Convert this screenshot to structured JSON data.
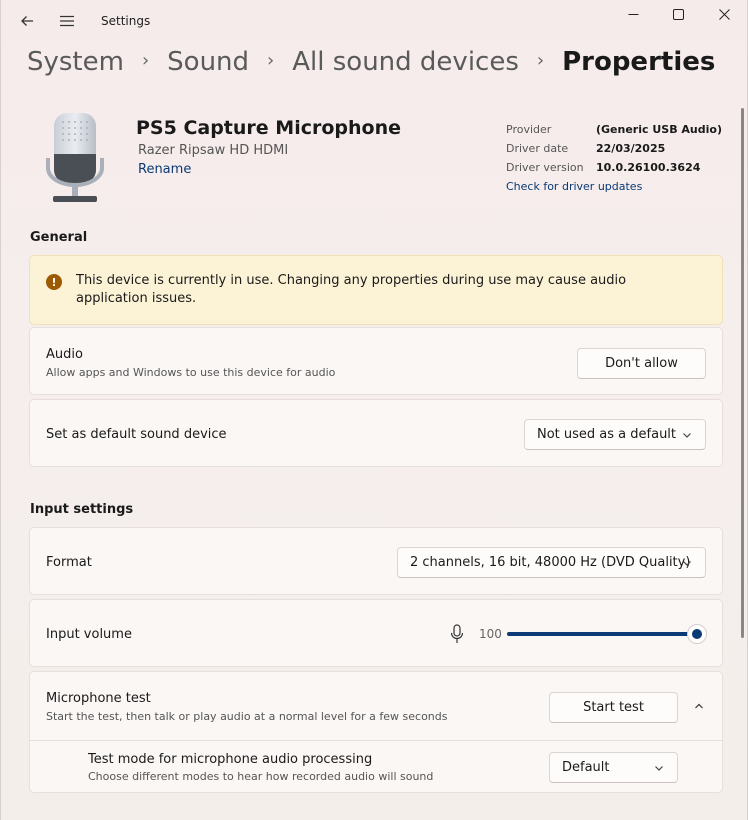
{
  "window": {
    "title": "Settings",
    "back_icon": "arrow-left-icon",
    "menu_icon": "hamburger-icon",
    "controls": [
      "minimize-icon",
      "maximize-icon",
      "close-icon"
    ]
  },
  "breadcrumb": {
    "items": [
      "System",
      "Sound",
      "All sound devices",
      "Properties"
    ],
    "separator": "›"
  },
  "device": {
    "icon": "microphone-device-icon",
    "name": "PS5 Capture Microphone",
    "subtitle": "Razer Ripsaw HD HDMI",
    "rename_label": "Rename",
    "provider_label": "Provider",
    "provider_value": "(Generic USB Audio)",
    "driver_date_label": "Driver date",
    "driver_date_value": "22/03/2025",
    "driver_version_label": "Driver version",
    "driver_version_value": "10.0.26100.3624",
    "driver_updates_link": "Check for driver updates"
  },
  "general": {
    "title": "General",
    "warning_icon": "warning-exclamation-icon",
    "warning_text": "This device is currently in use. Changing any properties during use may cause audio application issues.",
    "audio": {
      "title": "Audio",
      "subtitle": "Allow apps and Windows to use this device for audio",
      "button_label": "Don't allow"
    },
    "default_device": {
      "title": "Set as default sound device",
      "selected": "Not used as a default"
    }
  },
  "input_settings": {
    "title": "Input settings",
    "format": {
      "title": "Format",
      "selected": "2 channels, 16 bit, 48000 Hz (DVD Quality)"
    },
    "input_volume": {
      "title": "Input volume",
      "value": "100",
      "level_percent": 100
    },
    "mic_test": {
      "title": "Microphone test",
      "subtitle": "Start the test, then talk or play audio at a normal level for a few seconds",
      "button_label": "Start test",
      "expanded": true
    },
    "test_mode": {
      "title": "Test mode for microphone audio processing",
      "subtitle": "Choose different modes to hear how recorded audio will sound",
      "selected": "Default"
    }
  },
  "colors": {
    "accent": "#0b3a74",
    "warning_bg": "#fcf2d6",
    "warning_icon": "#9d5a00"
  }
}
